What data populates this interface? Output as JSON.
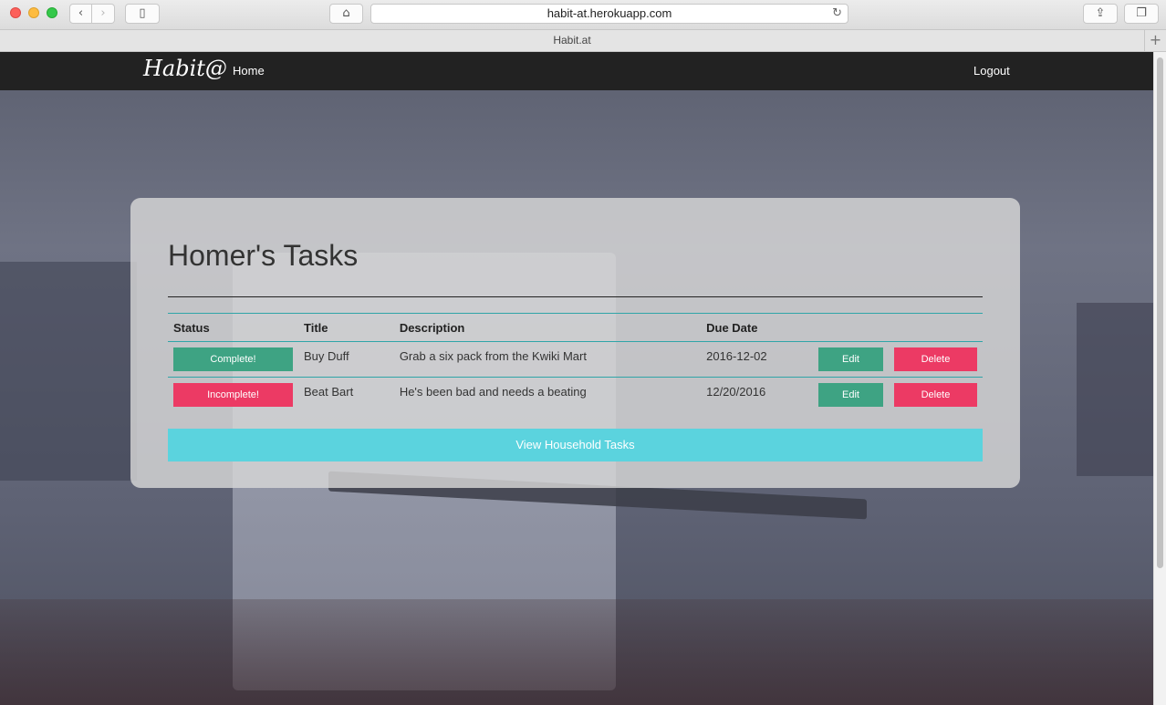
{
  "browser": {
    "url": "habit-at.herokuapp.com",
    "tab_title": "Habit.at",
    "back_glyph": "‹",
    "forward_glyph": "›",
    "sidebar_glyph": "▯",
    "home_glyph": "⌂",
    "reload_glyph": "↻",
    "share_glyph": "⇪",
    "tabs_glyph": "❐",
    "newtab_glyph": "+"
  },
  "nav": {
    "brand": "Habit@",
    "home": "Home",
    "logout": "Logout"
  },
  "card": {
    "title": "Homer's Tasks"
  },
  "table": {
    "headers": {
      "status": "Status",
      "title": "Title",
      "description": "Description",
      "due_date": "Due Date"
    },
    "rows": [
      {
        "status": "Complete!",
        "title": "Buy Duff",
        "description": "Grab a six pack from the Kwiki Mart",
        "due_date": "2016-12-02",
        "edit": "Edit",
        "delete": "Delete"
      },
      {
        "status": "Incomplete!",
        "title": "Beat Bart",
        "description": "He's been bad and needs a beating",
        "due_date": "12/20/2016",
        "edit": "Edit",
        "delete": "Delete"
      }
    ]
  },
  "household_button": "View Household Tasks",
  "colors": {
    "complete": "#3ea383",
    "incomplete": "#ec3a64",
    "household": "#5bd3de",
    "navbar": "#222222"
  }
}
